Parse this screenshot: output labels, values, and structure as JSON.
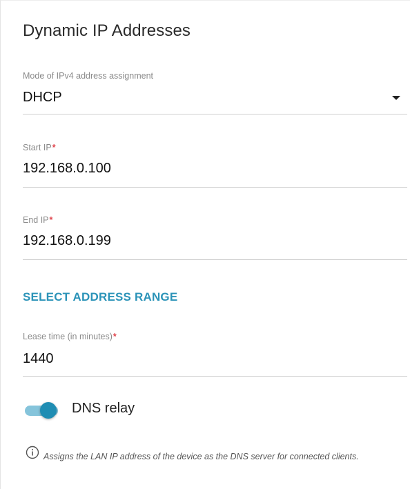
{
  "section": {
    "title": "Dynamic IP Addresses"
  },
  "fields": {
    "mode": {
      "label": "Mode of IPv4 address assignment",
      "value": "DHCP"
    },
    "start_ip": {
      "label": "Start IP",
      "required_mark": "*",
      "value": "192.168.0.100"
    },
    "end_ip": {
      "label": "End IP",
      "required_mark": "*",
      "value": "192.168.0.199"
    },
    "lease_time": {
      "label": "Lease time (in minutes)",
      "required_mark": "*",
      "value": "1440"
    }
  },
  "select_range": {
    "label": "SELECT ADDRESS RANGE"
  },
  "dns_relay": {
    "label": "DNS relay",
    "enabled": true
  },
  "hint": {
    "icon": "info-circle-icon",
    "text": "Assigns the LAN IP address of the device as the DNS server for connected clients."
  },
  "colors": {
    "accent": "#2b93b8",
    "toggle_thumb": "#1f8db3",
    "toggle_track": "#85c4db",
    "required": "#e0464e"
  }
}
